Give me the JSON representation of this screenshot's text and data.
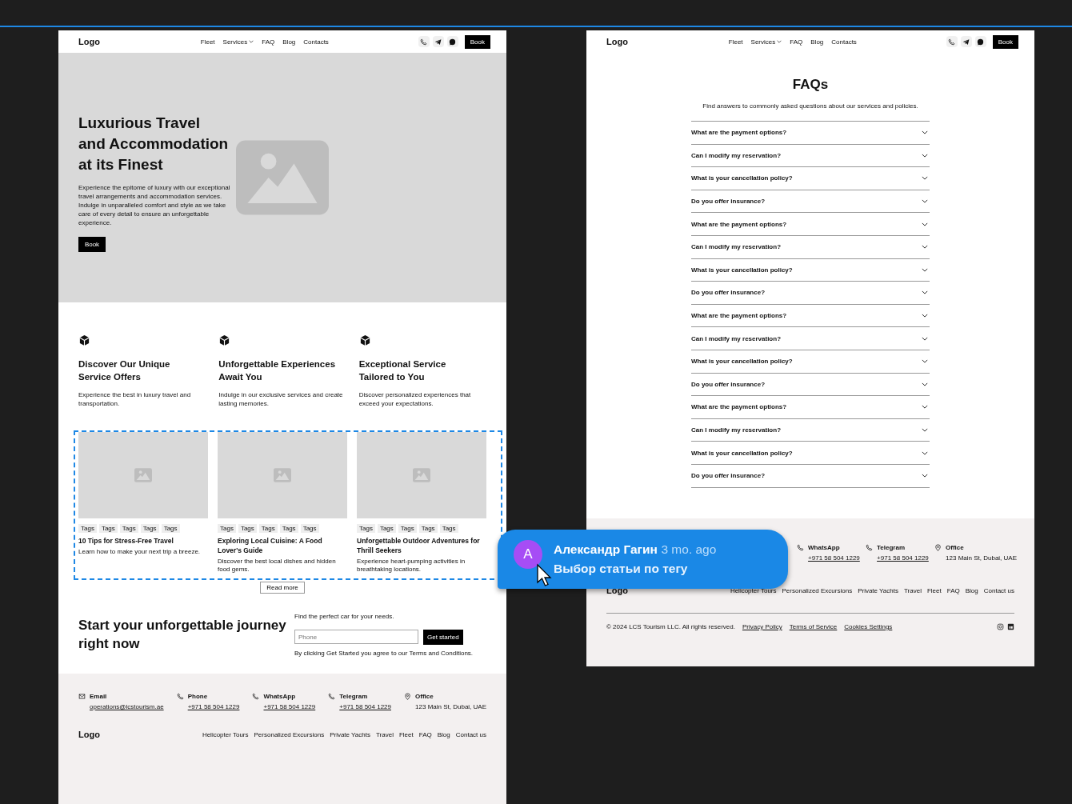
{
  "left_page": {
    "nav": {
      "logo": "Logo",
      "links": [
        {
          "label": "Fleet",
          "kind": "link"
        },
        {
          "label": "Services",
          "kind": "dropdown"
        },
        {
          "label": "FAQ",
          "kind": "link"
        },
        {
          "label": "Blog",
          "kind": "link"
        },
        {
          "label": "Contacts",
          "kind": "link"
        }
      ],
      "button": "Book"
    },
    "hero": {
      "title": "Luxurious Travel and Accommodation at its Finest",
      "text": "Experience the epitome of luxury with our exceptional travel arrangements and accommodation services. Indulge in unparalleled comfort and style as we take care of every detail to ensure an unforgettable experience.",
      "button": "Book"
    },
    "features": [
      {
        "title": "Discover Our Unique Service Offers",
        "text": "Experience the best in luxury travel and transportation."
      },
      {
        "title": "Unforgettable Experiences Await You",
        "text": "Indulge in our exclusive services and create lasting memories."
      },
      {
        "title": "Exceptional Service Tailored to You",
        "text": "Discover personalized experiences that exceed your expectations."
      }
    ],
    "blog": {
      "cards": [
        {
          "tags": [
            "Tags",
            "Tags",
            "Tags",
            "Tags",
            "Tags"
          ],
          "title": "10 Tips for Stress-Free Travel",
          "text": "Learn how to make your next trip a breeze."
        },
        {
          "tags": [
            "Tags",
            "Tags",
            "Tags",
            "Tags",
            "Tags"
          ],
          "title": "Exploring Local Cuisine: A Food Lover's Guide",
          "text": "Discover the best local dishes and hidden food gems."
        },
        {
          "tags": [
            "Tags",
            "Tags",
            "Tags",
            "Tags",
            "Tags"
          ],
          "title": "Unforgettable Outdoor Adventures for Thrill Seekers",
          "text": "Experience heart-pumping activities in breathtaking locations."
        }
      ],
      "button": "Read more"
    },
    "cta": {
      "title": "Start your unforgettable journey right now",
      "label": "Find the perfect car for your needs.",
      "placeholder": "Phone",
      "button": "Get started",
      "terms": "By clicking Get Started you agree to our Terms and Conditions."
    },
    "footer": {
      "contacts": [
        {
          "kind": "email",
          "label": "Email",
          "value": "operations@lcstourism.ae"
        },
        {
          "kind": "phone",
          "label": "Phone",
          "value": "+971 58 504 1229"
        },
        {
          "kind": "phone",
          "label": "WhatsApp",
          "value": "+971 58 504 1229"
        },
        {
          "kind": "phone",
          "label": "Telegram",
          "value": "+971 58 504 1229"
        },
        {
          "kind": "office",
          "label": "Office",
          "value": "123 Main St, Dubai, UAE"
        }
      ],
      "logo": "Logo",
      "links": [
        "Helicopter Tours",
        "Personalized Excursions",
        "Private Yachts",
        "Travel",
        "Fleet",
        "FAQ",
        "Blog",
        "Contact us"
      ]
    }
  },
  "right_page": {
    "nav": {
      "logo": "Logo",
      "links": [
        {
          "label": "Fleet",
          "kind": "link"
        },
        {
          "label": "Services",
          "kind": "dropdown"
        },
        {
          "label": "FAQ",
          "kind": "link"
        },
        {
          "label": "Blog",
          "kind": "link"
        },
        {
          "label": "Contacts",
          "kind": "link"
        }
      ],
      "button": "Book"
    },
    "faq": {
      "title": "FAQs",
      "subtitle": "Find answers to commonly asked questions about our services and policies.",
      "questions": [
        "What are the payment options?",
        "Can I modify my reservation?",
        "What is your cancellation policy?",
        "Do you offer insurance?",
        "What are the payment options?",
        "Can I modify my reservation?",
        "What is your cancellation policy?",
        "Do you offer insurance?",
        "What are the payment options?",
        "Can I modify my reservation?",
        "What is your cancellation policy?",
        "Do you offer insurance?",
        "What are the payment options?",
        "Can I modify my reservation?",
        "What is your cancellation policy?",
        "Do you offer insurance?"
      ]
    },
    "footer": {
      "contacts": [
        {
          "kind": "phone",
          "label": "WhatsApp",
          "value": "+971 58 504 1229"
        },
        {
          "kind": "phone",
          "label": "Telegram",
          "value": "+971 58 504 1229"
        },
        {
          "kind": "office",
          "label": "Office",
          "value": "123 Main St, Dubai, UAE"
        }
      ],
      "logo": "Logo",
      "links": [
        "Helicopter Tours",
        "Personalized Excursions",
        "Private Yachts",
        "Travel",
        "Fleet",
        "FAQ",
        "Blog",
        "Contact us"
      ],
      "copyright": "© 2024 LCS Tourism LLC. All rights reserved.",
      "legal_links": [
        "Privacy Policy",
        "Terms of Service",
        "Cookies Settings"
      ]
    }
  },
  "comment": {
    "avatar": "A",
    "author": "Александр Гагин",
    "time": "3 mo. ago",
    "text": "Выбор статьи по тегу"
  }
}
